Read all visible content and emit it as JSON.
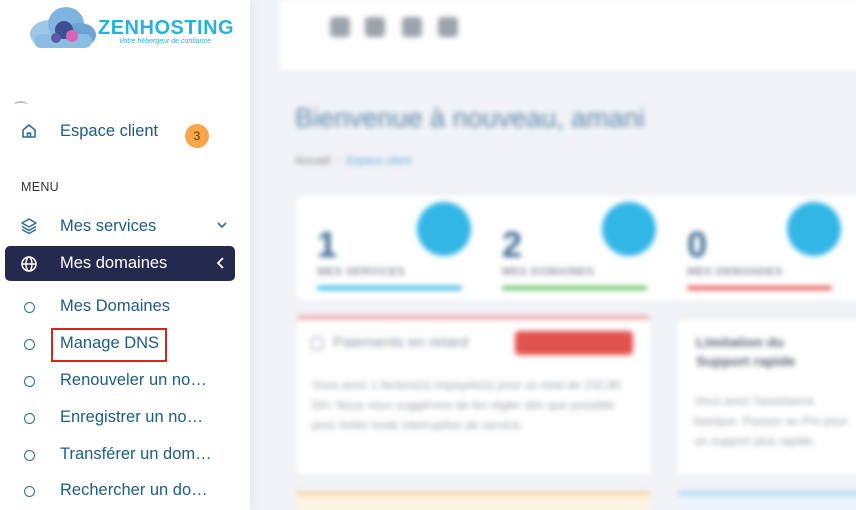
{
  "brand": {
    "name": "ZENHOSTING",
    "tagline": "Votre hébergeur de confiance"
  },
  "sidebar": {
    "home": {
      "label": "Espace client",
      "badge": "3"
    },
    "menu_title": "MENU",
    "services": {
      "label": "Mes services"
    },
    "domains": {
      "label": "Mes domaines"
    },
    "domain_subitems": [
      {
        "label": "Mes Domaines"
      },
      {
        "label": "Manage DNS"
      },
      {
        "label": "Renouveler un no…"
      },
      {
        "label": "Enregistrer un no…"
      },
      {
        "label": "Transférer un dom…"
      },
      {
        "label": "Rechercher un do…"
      }
    ]
  },
  "main": {
    "welcome": "Bienvenue à nouveau, amani",
    "breadcrumb": {
      "home": "Accueil",
      "current": "Espace client"
    },
    "stats": [
      {
        "value": "1",
        "caption": "MES SERVICES",
        "color": "#32b6e6"
      },
      {
        "value": "2",
        "caption": "MES DOMAINES",
        "color": "#5fbf5a"
      },
      {
        "value": "0",
        "caption": "MES DEMANDES",
        "color": "#e2524e"
      }
    ],
    "payment_card": {
      "title": "Paiements en retard",
      "text": "Vous avez 1 facture(s) impayée(s) pour un total de 232,80 DH. Nous vous suggérons de les régler dès que possible pour éviter toute interruption de service."
    },
    "side_card": {
      "title": "Limitation du Support rapide",
      "text": "Vous avez l'assistance basique. Passez au Pro pour un support plus rapide."
    }
  },
  "colors": {
    "active_bg": "#232a4d",
    "accent_blue": "#27b1dd",
    "badge_orange": "#f7a74b",
    "highlight_red": "#d32525"
  }
}
